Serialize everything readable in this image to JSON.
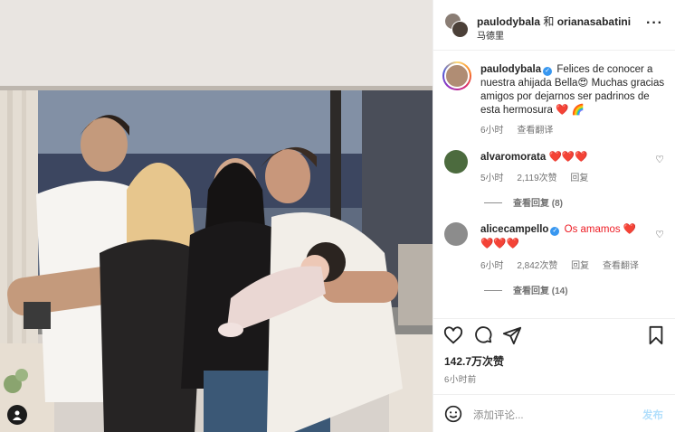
{
  "post": {
    "author_line": {
      "user1": "paulodybala",
      "joiner": "和",
      "user2": "orianasabatini"
    },
    "location": "马德里",
    "more_icon": "more-horizontal-icon"
  },
  "caption": {
    "username": "paulodybala",
    "text": "Felices de conocer a nuestra ahijada Bella😍 Muchas gracias amigos por dejarnos ser padrinos de esta hermosura ❤️ 🌈",
    "time": "6小时",
    "translate": "查看翻译"
  },
  "comments": [
    {
      "username": "alvaromorata",
      "text": "❤️❤️❤️",
      "time": "5小时",
      "likes": "2,119次赞",
      "reply": "回复",
      "view_replies": "查看回复 (8)"
    },
    {
      "username": "alicecampello",
      "text": "Os amamos ❤️ ❤️❤️❤️",
      "time": "6小时",
      "likes": "2,842次赞",
      "reply": "回复",
      "translate": "查看翻译",
      "view_replies": "查看回复 (14)"
    }
  ],
  "actions": {
    "likes": "142.7万次赞",
    "time": "6小时前"
  },
  "composer": {
    "placeholder": "添加评论...",
    "post": "发布"
  },
  "colors": {
    "verified": "#3897f0",
    "link_disabled": "#b2dffc",
    "muted": "#737373"
  }
}
